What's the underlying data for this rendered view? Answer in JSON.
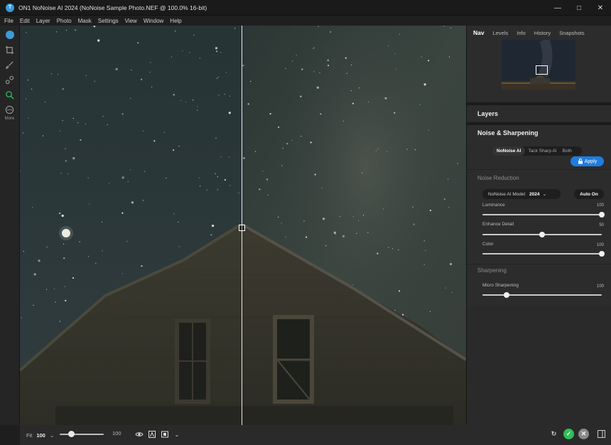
{
  "window": {
    "title": "ON1 NoNoise AI 2024 (NoNoise Sample Photo.NEF @ 100.0% 16-bit)",
    "controls": [
      "minimize",
      "maximize",
      "close"
    ]
  },
  "menu": [
    "File",
    "Edit",
    "Layer",
    "Photo",
    "Mask",
    "Settings",
    "View",
    "Window",
    "Help"
  ],
  "toolbar": {
    "tools": [
      "nonoise-logo-icon",
      "crop-icon",
      "brush-icon",
      "retouch-icon",
      "zoom-icon",
      "more-icon"
    ],
    "more_label": "More"
  },
  "bottom": {
    "fit_label": "Fit",
    "zoom_value": "100",
    "zoom_slider_max": "100",
    "zoom_fraction": 0.25
  },
  "panel": {
    "tabs": [
      "Nav",
      "Levels",
      "Info",
      "History",
      "Snapshots"
    ],
    "active_tab": "Nav",
    "layers_label": "Layers",
    "section_title": "Noise & Sharpening",
    "modes": [
      "NoNoise AI",
      "Tack Sharp AI",
      "Both"
    ],
    "active_mode": "NoNoise AI",
    "apply_label": "Apply",
    "noise_reduction_label": "Noise Reduction",
    "model_label": "NoNoise AI Model",
    "model_value": "2024",
    "auto_label": "Auto On",
    "sliders": [
      {
        "label": "Luminance",
        "value": "100",
        "fraction": 1.0
      },
      {
        "label": "Enhance Detail",
        "value": "50",
        "fraction": 0.5
      },
      {
        "label": "Color",
        "value": "100",
        "fraction": 1.0
      }
    ],
    "sharpening_label": "Sharpening",
    "sharpening_sliders": [
      {
        "label": "Micro Sharpening",
        "value": "100",
        "fraction": 0.2
      }
    ]
  },
  "colors": {
    "accent": "#1e7de0",
    "confirm": "#2fbf5a",
    "cancel": "#8a8a8a"
  }
}
